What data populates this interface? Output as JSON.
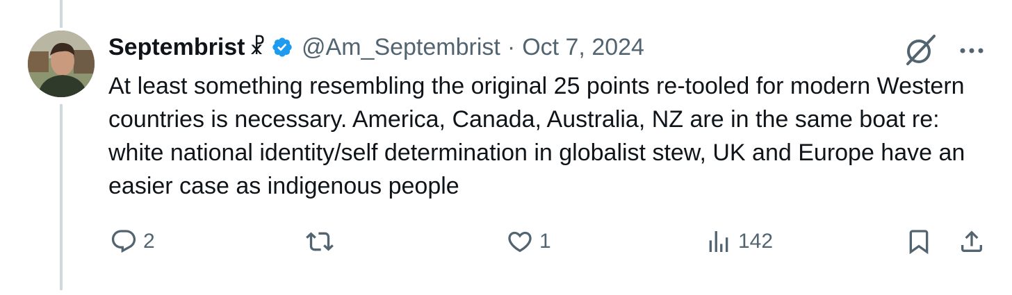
{
  "tweet": {
    "display_name": "Septembrist",
    "name_symbol": "☧",
    "handle": "@Am_Septembrist",
    "separator": "·",
    "date": "Oct 7, 2024",
    "text": "At least something resembling the original 25 points re-tooled for modern Western countries is necessary. America, Canada, Australia, NZ are in the same boat re: white national identity/self determination in globalist stew, UK and Europe have an easier case as indigenous people"
  },
  "actions": {
    "reply_count": "2",
    "retweet_count": "",
    "like_count": "1",
    "views_count": "142"
  },
  "colors": {
    "text": "#0f1419",
    "secondary": "#536471",
    "verified": "#1d9bf0",
    "thread_line": "#cfd9de"
  },
  "icons": [
    "verified-badge-icon",
    "grok-icon",
    "more-icon",
    "reply-icon",
    "retweet-icon",
    "like-icon",
    "views-icon",
    "bookmark-icon",
    "share-icon"
  ]
}
